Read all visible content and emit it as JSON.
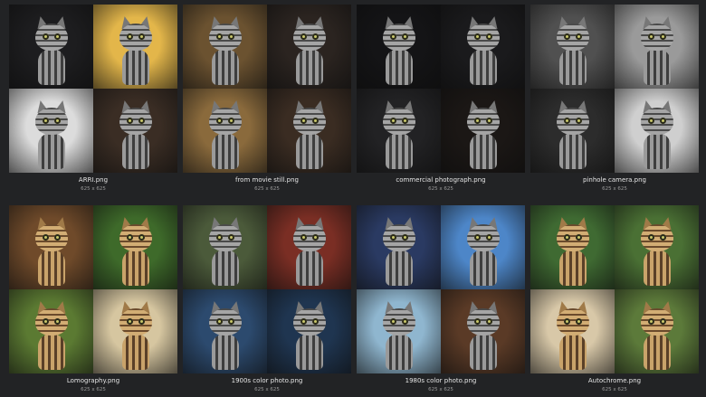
{
  "files": [
    {
      "name": "ARRI.png",
      "dims": "625 x 625",
      "colors": [
        "#1d1d1f",
        "#e3b64a",
        "#dcdcdc",
        "#3a2d24"
      ],
      "warm": false
    },
    {
      "name": "from movie still.png",
      "dims": "625 x 625",
      "colors": [
        "#6b5230",
        "#2b2420",
        "#8a6a3c",
        "#3a2c22"
      ],
      "warm": false
    },
    {
      "name": "commercial photograph.png",
      "dims": "625 x 625",
      "colors": [
        "#141416",
        "#1a1a1c",
        "#222224",
        "#1b1715"
      ],
      "warm": false
    },
    {
      "name": "pinhole camera.png",
      "dims": "625 x 625",
      "colors": [
        "#505050",
        "#9a9a9a",
        "#2c2c2c",
        "#cfcfcf"
      ],
      "warm": false
    },
    {
      "name": "Lomography.png",
      "dims": "625 x 625",
      "colors": [
        "#6f4a2a",
        "#3e6a2a",
        "#5b7a32",
        "#d6c6a0"
      ],
      "warm": true
    },
    {
      "name": "1900s color photo.png",
      "dims": "625 x 625",
      "colors": [
        "#4b5a3a",
        "#7a2e24",
        "#2c4a6e",
        "#1f3550"
      ],
      "warm": false
    },
    {
      "name": "1980s color photo.png",
      "dims": "625 x 625",
      "colors": [
        "#2a3a62",
        "#4d86c8",
        "#8fb6cf",
        "#5a3a26"
      ],
      "warm": false
    },
    {
      "name": "Autochrome.png",
      "dims": "625 x 625",
      "colors": [
        "#3f6a32",
        "#4a7034",
        "#d8c8a8",
        "#5c7a3a"
      ],
      "warm": true
    }
  ]
}
